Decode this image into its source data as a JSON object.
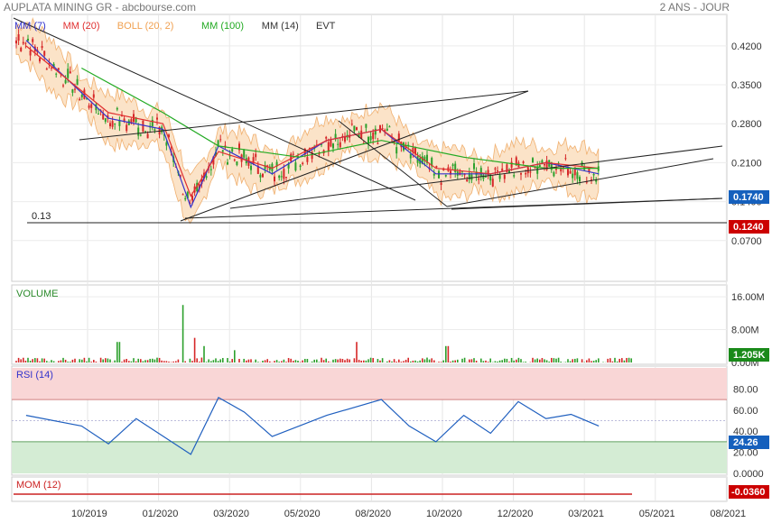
{
  "header": {
    "title": "AUPLATA MINING GR - abcbourse.com",
    "period": "2 ANS - JOUR"
  },
  "legend": [
    {
      "label": "MM (7)",
      "color": "#3333cc"
    },
    {
      "label": "MM (20)",
      "color": "#e03030"
    },
    {
      "label": "BOLL (20, 2)",
      "color": "#f0a050"
    },
    {
      "label": "MM (100)",
      "color": "#22aa22"
    },
    {
      "label": "MM (14)",
      "color": "#333333"
    },
    {
      "label": "EVT",
      "color": "#333333"
    }
  ],
  "colors": {
    "up": "#2ca02c",
    "down": "#d62728",
    "boll_fill": "#fbe3c8",
    "rsi_over": "#f9d6d6",
    "rsi_under": "#d4ecd4",
    "price_tag": "#1560bd",
    "support_tag": "#cc0000"
  },
  "chart_data": [
    {
      "type": "candlestick",
      "panel": "price",
      "y_ticks": [
        "0.4200",
        "0.3500",
        "0.2800",
        "0.2100",
        "0.1400",
        "0.0700"
      ],
      "ylim": [
        0.0,
        0.47
      ],
      "x_ticks": [
        "10/2019",
        "01/2020",
        "03/2020",
        "05/2020",
        "08/2020",
        "10/2020",
        "12/2020",
        "03/2021",
        "05/2021",
        "08/2021"
      ],
      "series": [
        {
          "name": "MM (7)",
          "x": [
            "2019-07",
            "2019-10",
            "2019-12",
            "2020-01",
            "2020-02",
            "2020-04",
            "2020-06",
            "2020-08",
            "2020-10",
            "2020-12",
            "2021-02",
            "2021-04"
          ],
          "values": [
            0.43,
            0.29,
            0.27,
            0.13,
            0.24,
            0.19,
            0.25,
            0.27,
            0.19,
            0.19,
            0.21,
            0.19
          ]
        },
        {
          "name": "MM (20)",
          "x": [
            "2019-07",
            "2019-10",
            "2019-12",
            "2020-01",
            "2020-02",
            "2020-04",
            "2020-06",
            "2020-08",
            "2020-10",
            "2020-12",
            "2021-02",
            "2021-04"
          ],
          "values": [
            0.42,
            0.3,
            0.28,
            0.15,
            0.23,
            0.2,
            0.25,
            0.27,
            0.2,
            0.19,
            0.21,
            0.2
          ]
        },
        {
          "name": "MM (100)",
          "x": [
            "2019-09",
            "2019-12",
            "2020-02",
            "2020-05",
            "2020-08",
            "2020-11",
            "2021-02",
            "2021-04"
          ],
          "values": [
            0.38,
            0.3,
            0.24,
            0.22,
            0.25,
            0.22,
            0.2,
            0.2
          ]
        }
      ],
      "support_line_value": 0.124,
      "support_line_label": "0.13",
      "last_price": "0.1740",
      "support_price": "0.1240"
    },
    {
      "type": "bar",
      "panel": "volume",
      "title": "VOLUME",
      "y_ticks": [
        "16.00M",
        "8.00M",
        "0.00M"
      ],
      "ylim": [
        0,
        18000000
      ],
      "last_value": "1.205K"
    },
    {
      "type": "line",
      "panel": "rsi",
      "title": "RSI (14)",
      "y_ticks": [
        "80.00",
        "60.00",
        "40.00",
        "20.00",
        "0.0000"
      ],
      "ylim": [
        0,
        100
      ],
      "x": [
        "2019-07",
        "2019-09",
        "2019-10",
        "2019-11",
        "2020-01",
        "2020-02",
        "2020-03",
        "2020-04",
        "2020-06",
        "2020-08",
        "2020-09",
        "2020-10",
        "2020-11",
        "2020-12",
        "2021-01",
        "2021-02",
        "2021-03",
        "2021-04"
      ],
      "values": [
        55,
        45,
        28,
        52,
        18,
        72,
        58,
        35,
        55,
        70,
        45,
        30,
        55,
        38,
        68,
        52,
        56,
        45
      ],
      "last_value": "24.26"
    },
    {
      "type": "line",
      "panel": "momentum",
      "title": "MOM (12)",
      "ylim": [
        -0.1,
        0.1
      ],
      "last_value": "-0.0360"
    }
  ]
}
